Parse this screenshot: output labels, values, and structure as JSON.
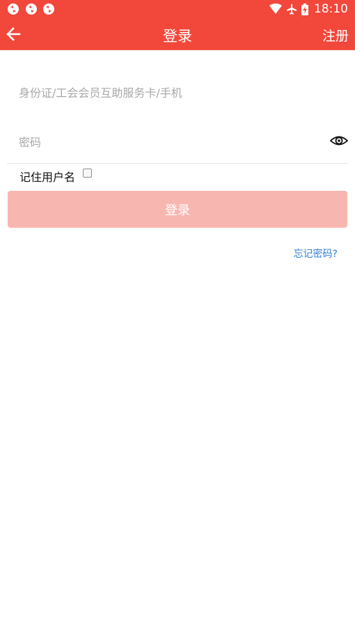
{
  "status_bar": {
    "time": "18:10",
    "notification_icons": [
      "sync-icon",
      "sync-icon",
      "sync-icon"
    ],
    "status_icons": [
      "wifi-icon",
      "airplane-mode-icon",
      "battery-charging-icon"
    ]
  },
  "app_bar": {
    "title": "登录",
    "register_label": "注册",
    "background_color": "#f2473b"
  },
  "form": {
    "account_placeholder": "身份证/工会会员互助服务卡/手机",
    "password_placeholder": "密码",
    "remember_label": "记住用户名",
    "remember_checked": false,
    "login_label": "登录",
    "login_button_color": "#f8b6b1",
    "forgot_label": "忘记密码?"
  }
}
